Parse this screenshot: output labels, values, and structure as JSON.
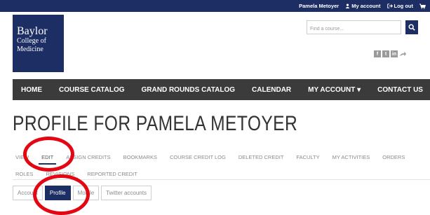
{
  "topbar": {
    "user_name": "Pamela Metoyer",
    "my_account": "My account",
    "log_out": "Log out"
  },
  "logo": {
    "line1": "Baylor",
    "line2": "College of",
    "line3": "Medicine"
  },
  "search": {
    "placeholder": "Find a course..."
  },
  "nav": {
    "items": [
      {
        "label": "HOME"
      },
      {
        "label": "COURSE CATALOG"
      },
      {
        "label": "GRAND ROUNDS CATALOG"
      },
      {
        "label": "CALENDAR"
      },
      {
        "label": "MY ACCOUNT ▾"
      },
      {
        "label": "CONTACT US"
      }
    ]
  },
  "page_title": "PROFILE FOR PAMELA METOYER",
  "tabs": {
    "row1": [
      "VIEW",
      "EDIT",
      "ASSIGN CREDITS",
      "BOOKMARKS",
      "COURSE CREDIT LOG",
      "DELETED CREDIT",
      "FACULTY",
      "MY ACTIVITIES",
      "ORDERS"
    ],
    "row2": [
      "ROLES",
      "REVISIONS",
      "REPORTED CREDIT"
    ],
    "active": "EDIT"
  },
  "subtabs": {
    "items": [
      "Account",
      "Profile",
      "Mobile",
      "Twitter accounts"
    ],
    "active": "Profile"
  },
  "colors": {
    "brand_navy": "#1c2e63",
    "nav_dark": "#3b3b3b",
    "annotation_red": "#e30613"
  }
}
